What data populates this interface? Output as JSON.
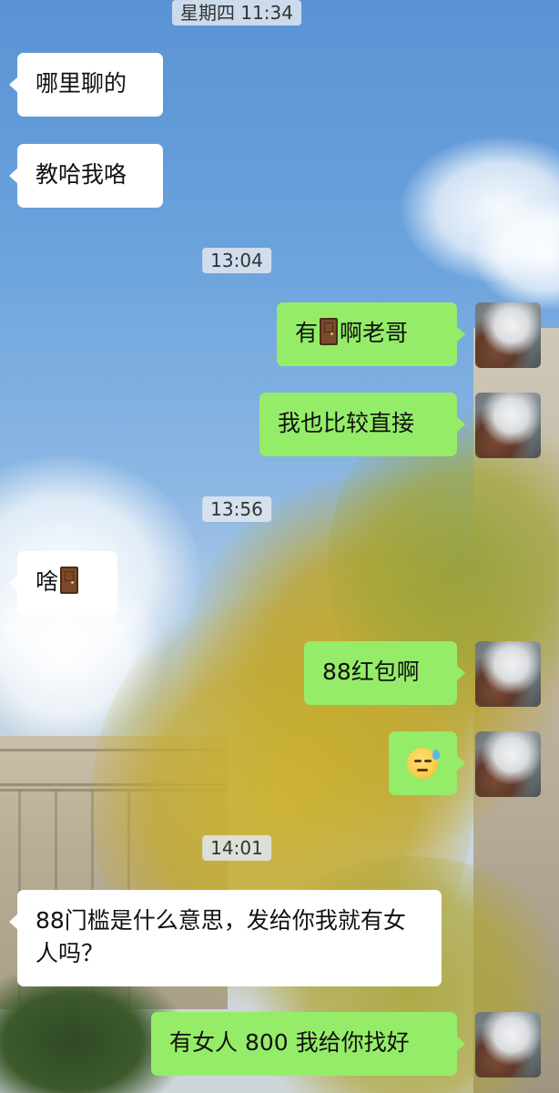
{
  "chat": {
    "timestamps": [
      "星期四 11:34",
      "13:04",
      "13:56",
      "14:01"
    ],
    "messages": [
      {
        "side": "left",
        "text": "哪里聊的"
      },
      {
        "side": "left",
        "text": "教哈我咯"
      },
      {
        "side": "right",
        "before": "有",
        "icon": "door-icon",
        "after": "啊老哥"
      },
      {
        "side": "right",
        "text": "我也比较直接"
      },
      {
        "side": "left",
        "before": "啥",
        "icon": "door-icon",
        "after": ""
      },
      {
        "side": "right",
        "text": "88红包啊"
      },
      {
        "side": "right",
        "icon": "sweat-smile-icon"
      },
      {
        "side": "left",
        "text": "88门槛是什么意思，发给你我就有女人吗？"
      },
      {
        "side": "right",
        "text": "有女人 800 我给你找好"
      }
    ]
  },
  "colors": {
    "self_bubble": "#95ec69",
    "other_bubble": "#ffffff",
    "timestamp_bg": "#e1e8f0"
  }
}
